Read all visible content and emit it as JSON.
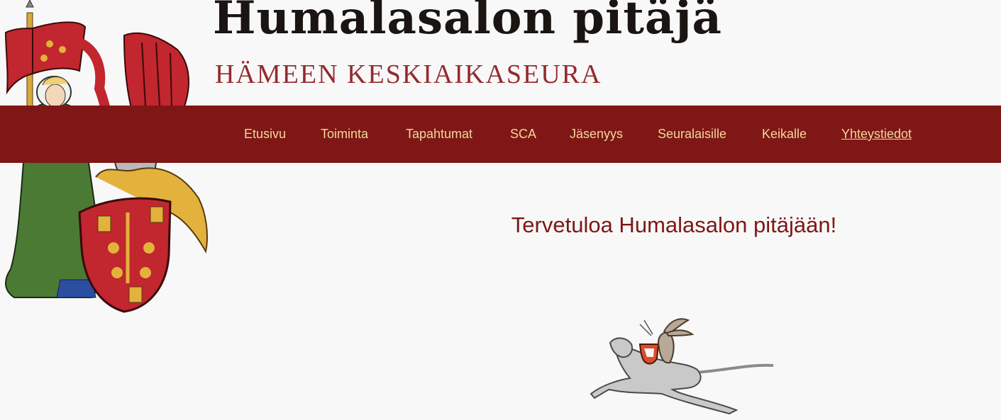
{
  "header": {
    "title": "Humalasalon pitäjä",
    "subtitle": "HÄMEEN KESKIAIKASEURA"
  },
  "nav": {
    "items": [
      {
        "label": "Etusivu"
      },
      {
        "label": "Toiminta"
      },
      {
        "label": "Tapahtumat"
      },
      {
        "label": "SCA"
      },
      {
        "label": "Jäsenyys"
      },
      {
        "label": "Seuralaisille"
      },
      {
        "label": "Keikalle"
      },
      {
        "label": "Yhteystiedot",
        "active": true
      }
    ]
  },
  "main": {
    "heading": "Tervetuloa Humalasalon pitäjään!"
  },
  "colors": {
    "brand_red": "#7e1716",
    "nav_text": "#f3d89a",
    "background": "#f8f8f8"
  },
  "images": {
    "crest": "heraldic-crest-with-lady-and-banner",
    "decoration": "rabbit-riding-hound-illustration"
  }
}
